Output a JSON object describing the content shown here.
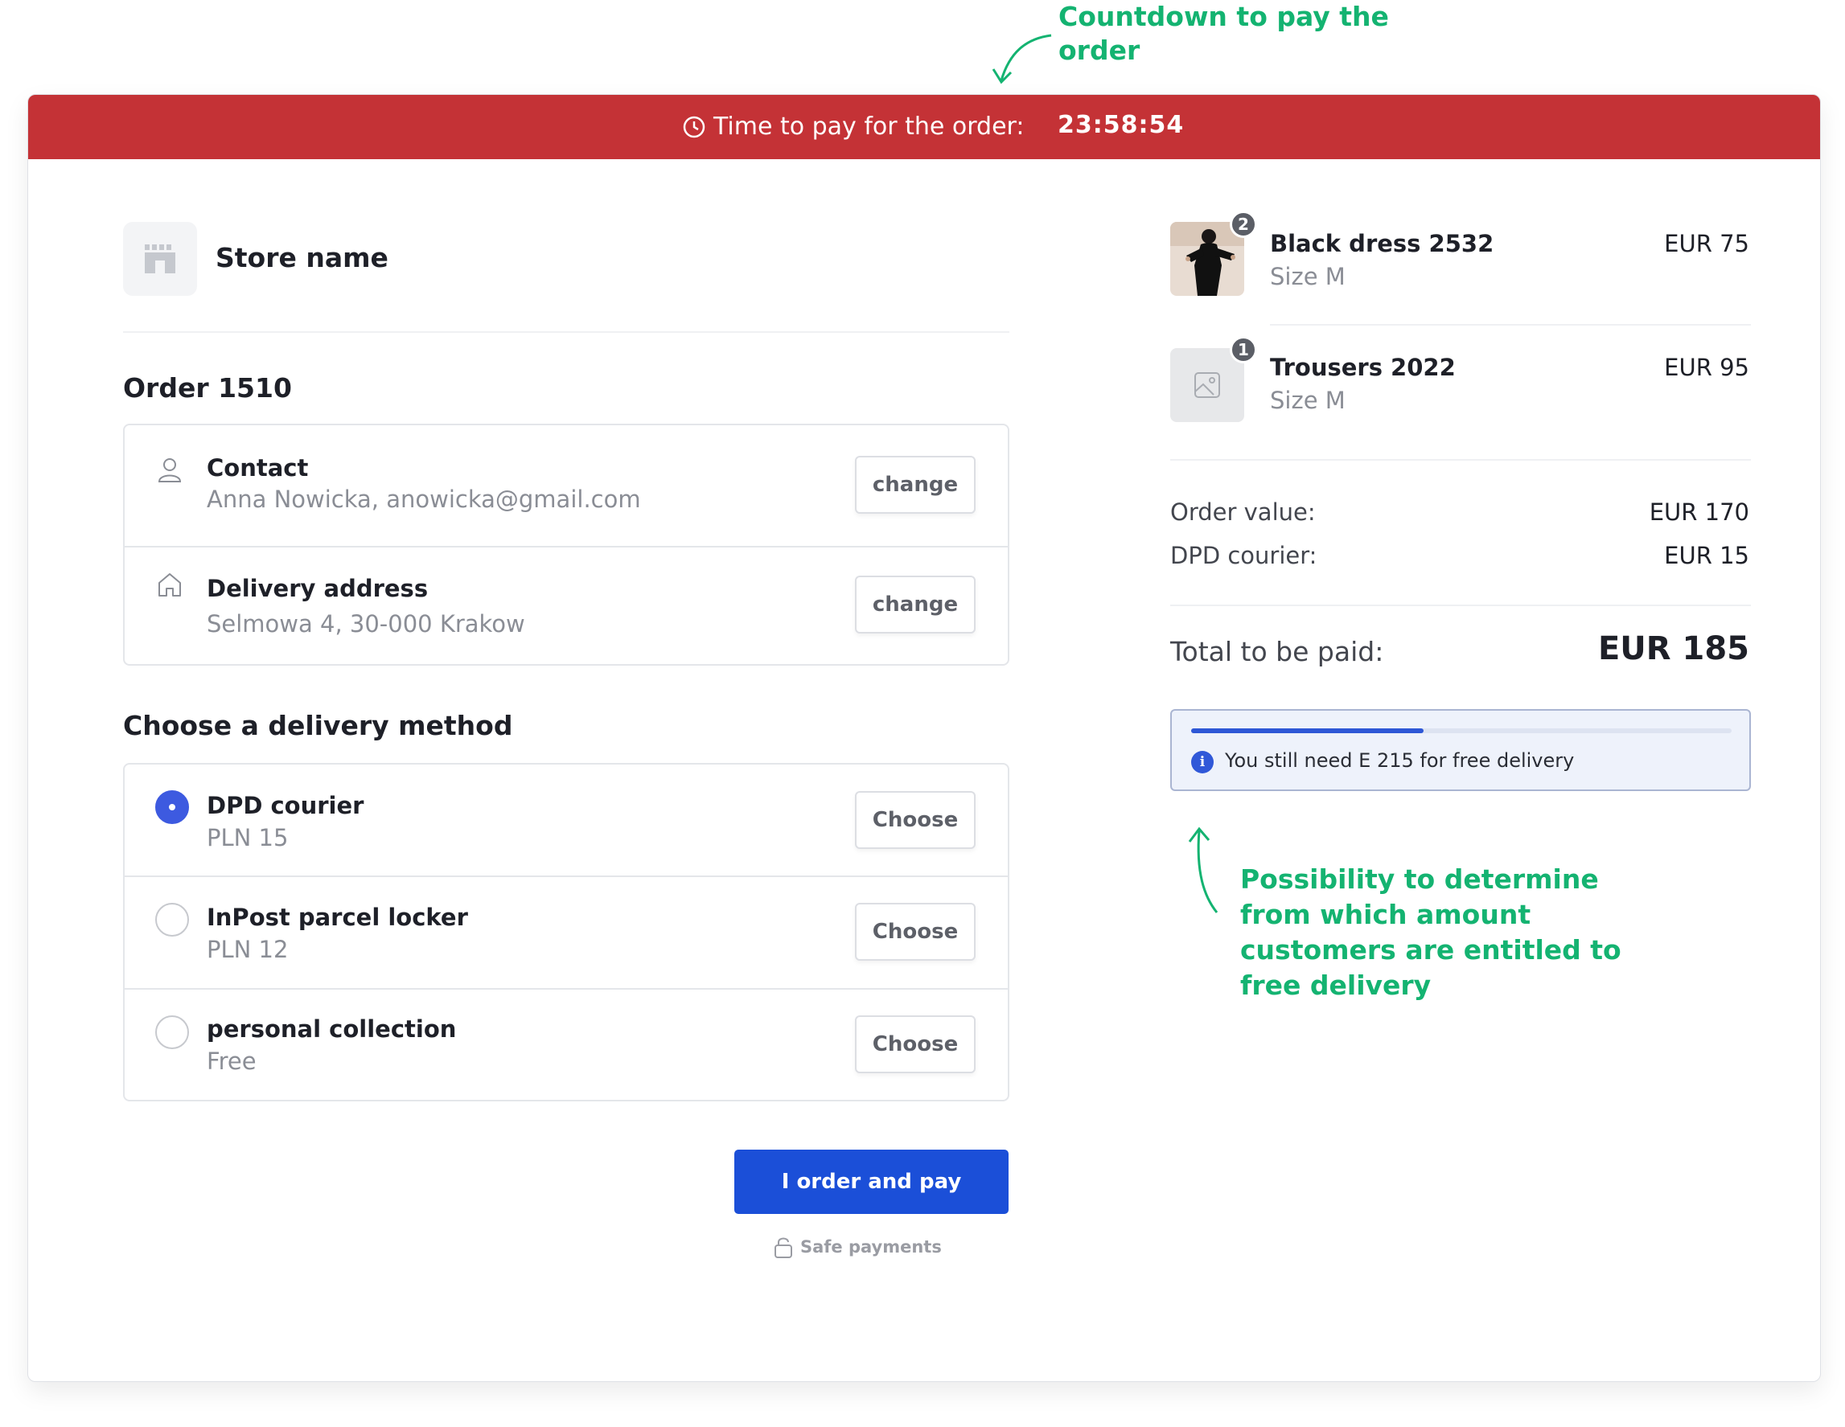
{
  "annotations": {
    "countdown": "Countdown to pay the order",
    "free_delivery": "Possibility to determine from which amount customers are entitled to free delivery"
  },
  "banner": {
    "label": "Time to pay for the order:",
    "timer": "23:58:54",
    "color": "#c43236"
  },
  "store": {
    "name": "Store name"
  },
  "order": {
    "title": "Order 1510",
    "contact": {
      "title": "Contact",
      "value": "Anna Nowicka, anowicka@gmail.com",
      "button": "change"
    },
    "address": {
      "title": "Delivery address",
      "value": "Selmowa 4, 30-000 Krakow",
      "button": "change"
    }
  },
  "delivery": {
    "title": "Choose a delivery method",
    "options": [
      {
        "name": "DPD courier",
        "price": "PLN 15",
        "button": "Choose",
        "selected": true
      },
      {
        "name": "InPost parcel locker",
        "price": "PLN 12",
        "button": "Choose",
        "selected": false
      },
      {
        "name": "personal collection",
        "price": "Free",
        "button": "Choose",
        "selected": false
      }
    ]
  },
  "checkout": {
    "pay_label": "I order and pay",
    "safe_label": "Safe payments",
    "accent": "#1b4fd8"
  },
  "cart": {
    "items": [
      {
        "name": "Black dress 2532",
        "size": "Size M",
        "price": "EUR 75",
        "qty": "2",
        "icon": "product-photo"
      },
      {
        "name": "Trousers 2022",
        "size": "Size M",
        "price": "EUR 95",
        "qty": "1",
        "icon": "image-placeholder-icon"
      }
    ],
    "order_value_label": "Order value:",
    "order_value": "EUR 170",
    "shipping_label": "DPD courier:",
    "shipping_value": "EUR 15",
    "total_label": "Total to be paid:",
    "total_value": "EUR 185",
    "free_delivery": {
      "text": "You still need E 215 for free delivery",
      "progress": 0.43
    }
  }
}
